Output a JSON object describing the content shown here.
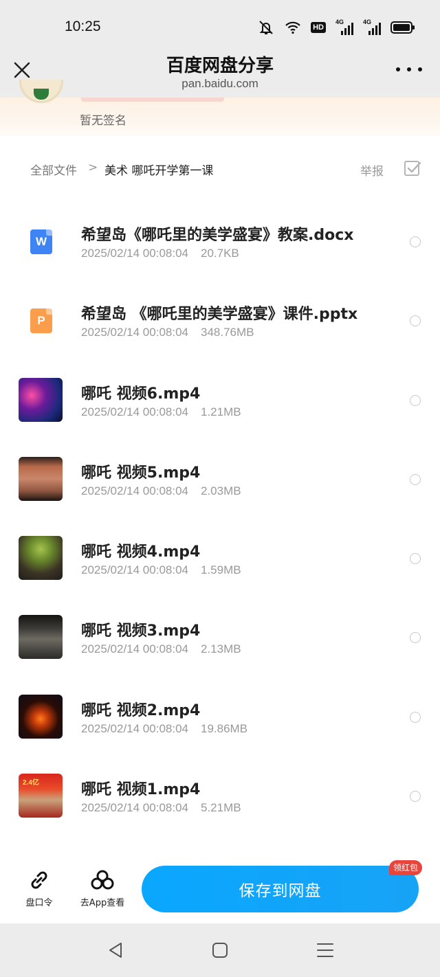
{
  "status_bar": {
    "time": "10:25",
    "hd_label": "HD",
    "signal1_label": "4G",
    "signal2_label": "4G"
  },
  "header": {
    "title": "百度网盘分享",
    "url": "pan.baidu.com"
  },
  "profile": {
    "signature": "暂无签名"
  },
  "breadcrumb": {
    "root": "全部文件",
    "separator": ">",
    "current": "美术 哪吒开学第一课",
    "report": "举报"
  },
  "files": [
    {
      "name": "希望岛《哪吒里的美学盛宴》教案.docx",
      "date": "2025/02/14 00:08:04",
      "size": "20.7KB",
      "icon": "word-doc-icon",
      "icon_letter": "W"
    },
    {
      "name": "希望岛 《哪吒里的美学盛宴》课件.pptx",
      "date": "2025/02/14 00:08:04",
      "size": "348.76MB",
      "icon": "ppt-doc-icon",
      "icon_letter": "P"
    },
    {
      "name": "哪吒 视频6.mp4",
      "date": "2025/02/14 00:08:04",
      "size": "1.21MB",
      "icon": "video-thumbnail"
    },
    {
      "name": "哪吒 视频5.mp4",
      "date": "2025/02/14 00:08:04",
      "size": "2.03MB",
      "icon": "video-thumbnail"
    },
    {
      "name": "哪吒 视频4.mp4",
      "date": "2025/02/14 00:08:04",
      "size": "1.59MB",
      "icon": "video-thumbnail"
    },
    {
      "name": "哪吒 视频3.mp4",
      "date": "2025/02/14 00:08:04",
      "size": "2.13MB",
      "icon": "video-thumbnail"
    },
    {
      "name": "哪吒 视频2.mp4",
      "date": "2025/02/14 00:08:04",
      "size": "19.86MB",
      "icon": "video-thumbnail"
    },
    {
      "name": "哪吒 视频1.mp4",
      "date": "2025/02/14 00:08:04",
      "size": "5.21MB",
      "icon": "video-thumbnail",
      "thumb_text": "2.4亿"
    }
  ],
  "actions": {
    "code_label": "盘口令",
    "app_label": "去App查看",
    "save_label": "保存到网盘",
    "badge": "领红包"
  },
  "colors": {
    "accent": "#0aa7ff",
    "badge": "#e8453c",
    "word": "#3f84f4",
    "ppt": "#fa9d4c"
  }
}
